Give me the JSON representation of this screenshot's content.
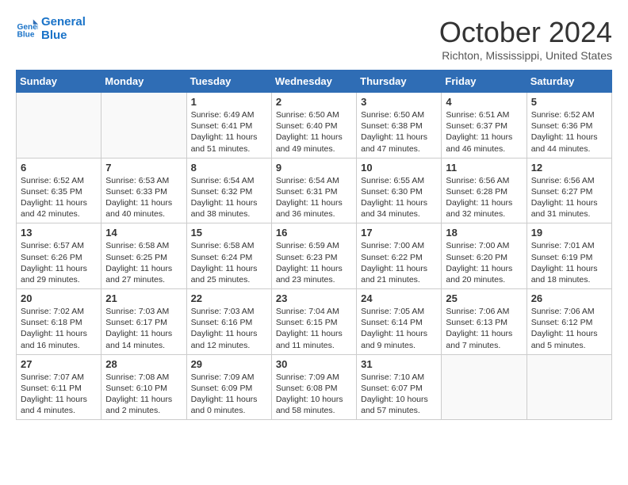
{
  "logo": {
    "line1": "General",
    "line2": "Blue"
  },
  "title": "October 2024",
  "location": "Richton, Mississippi, United States",
  "weekdays": [
    "Sunday",
    "Monday",
    "Tuesday",
    "Wednesday",
    "Thursday",
    "Friday",
    "Saturday"
  ],
  "weeks": [
    [
      {
        "day": "",
        "content": ""
      },
      {
        "day": "",
        "content": ""
      },
      {
        "day": "1",
        "content": "Sunrise: 6:49 AM\nSunset: 6:41 PM\nDaylight: 11 hours and 51 minutes."
      },
      {
        "day": "2",
        "content": "Sunrise: 6:50 AM\nSunset: 6:40 PM\nDaylight: 11 hours and 49 minutes."
      },
      {
        "day": "3",
        "content": "Sunrise: 6:50 AM\nSunset: 6:38 PM\nDaylight: 11 hours and 47 minutes."
      },
      {
        "day": "4",
        "content": "Sunrise: 6:51 AM\nSunset: 6:37 PM\nDaylight: 11 hours and 46 minutes."
      },
      {
        "day": "5",
        "content": "Sunrise: 6:52 AM\nSunset: 6:36 PM\nDaylight: 11 hours and 44 minutes."
      }
    ],
    [
      {
        "day": "6",
        "content": "Sunrise: 6:52 AM\nSunset: 6:35 PM\nDaylight: 11 hours and 42 minutes."
      },
      {
        "day": "7",
        "content": "Sunrise: 6:53 AM\nSunset: 6:33 PM\nDaylight: 11 hours and 40 minutes."
      },
      {
        "day": "8",
        "content": "Sunrise: 6:54 AM\nSunset: 6:32 PM\nDaylight: 11 hours and 38 minutes."
      },
      {
        "day": "9",
        "content": "Sunrise: 6:54 AM\nSunset: 6:31 PM\nDaylight: 11 hours and 36 minutes."
      },
      {
        "day": "10",
        "content": "Sunrise: 6:55 AM\nSunset: 6:30 PM\nDaylight: 11 hours and 34 minutes."
      },
      {
        "day": "11",
        "content": "Sunrise: 6:56 AM\nSunset: 6:28 PM\nDaylight: 11 hours and 32 minutes."
      },
      {
        "day": "12",
        "content": "Sunrise: 6:56 AM\nSunset: 6:27 PM\nDaylight: 11 hours and 31 minutes."
      }
    ],
    [
      {
        "day": "13",
        "content": "Sunrise: 6:57 AM\nSunset: 6:26 PM\nDaylight: 11 hours and 29 minutes."
      },
      {
        "day": "14",
        "content": "Sunrise: 6:58 AM\nSunset: 6:25 PM\nDaylight: 11 hours and 27 minutes."
      },
      {
        "day": "15",
        "content": "Sunrise: 6:58 AM\nSunset: 6:24 PM\nDaylight: 11 hours and 25 minutes."
      },
      {
        "day": "16",
        "content": "Sunrise: 6:59 AM\nSunset: 6:23 PM\nDaylight: 11 hours and 23 minutes."
      },
      {
        "day": "17",
        "content": "Sunrise: 7:00 AM\nSunset: 6:22 PM\nDaylight: 11 hours and 21 minutes."
      },
      {
        "day": "18",
        "content": "Sunrise: 7:00 AM\nSunset: 6:20 PM\nDaylight: 11 hours and 20 minutes."
      },
      {
        "day": "19",
        "content": "Sunrise: 7:01 AM\nSunset: 6:19 PM\nDaylight: 11 hours and 18 minutes."
      }
    ],
    [
      {
        "day": "20",
        "content": "Sunrise: 7:02 AM\nSunset: 6:18 PM\nDaylight: 11 hours and 16 minutes."
      },
      {
        "day": "21",
        "content": "Sunrise: 7:03 AM\nSunset: 6:17 PM\nDaylight: 11 hours and 14 minutes."
      },
      {
        "day": "22",
        "content": "Sunrise: 7:03 AM\nSunset: 6:16 PM\nDaylight: 11 hours and 12 minutes."
      },
      {
        "day": "23",
        "content": "Sunrise: 7:04 AM\nSunset: 6:15 PM\nDaylight: 11 hours and 11 minutes."
      },
      {
        "day": "24",
        "content": "Sunrise: 7:05 AM\nSunset: 6:14 PM\nDaylight: 11 hours and 9 minutes."
      },
      {
        "day": "25",
        "content": "Sunrise: 7:06 AM\nSunset: 6:13 PM\nDaylight: 11 hours and 7 minutes."
      },
      {
        "day": "26",
        "content": "Sunrise: 7:06 AM\nSunset: 6:12 PM\nDaylight: 11 hours and 5 minutes."
      }
    ],
    [
      {
        "day": "27",
        "content": "Sunrise: 7:07 AM\nSunset: 6:11 PM\nDaylight: 11 hours and 4 minutes."
      },
      {
        "day": "28",
        "content": "Sunrise: 7:08 AM\nSunset: 6:10 PM\nDaylight: 11 hours and 2 minutes."
      },
      {
        "day": "29",
        "content": "Sunrise: 7:09 AM\nSunset: 6:09 PM\nDaylight: 11 hours and 0 minutes."
      },
      {
        "day": "30",
        "content": "Sunrise: 7:09 AM\nSunset: 6:08 PM\nDaylight: 10 hours and 58 minutes."
      },
      {
        "day": "31",
        "content": "Sunrise: 7:10 AM\nSunset: 6:07 PM\nDaylight: 10 hours and 57 minutes."
      },
      {
        "day": "",
        "content": ""
      },
      {
        "day": "",
        "content": ""
      }
    ]
  ]
}
